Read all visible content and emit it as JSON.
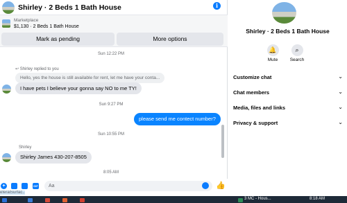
{
  "header": {
    "title": "Shirley · 2 Beds 1 Bath House",
    "info_icon": "info-icon"
  },
  "listing": {
    "category": "Marketplace",
    "summary": "$1,130 · 2 Beds 1 Bath House",
    "mark_pending_label": "Mark as pending",
    "more_options_label": "More options"
  },
  "messages": {
    "ts1": "Sun 12:22 PM",
    "reply_note": "Shirley replied to you",
    "quoted": "Hello, yes the house is still available for rent, let me have your conta...",
    "msg1": "I have pets I believe your gonna say NO to me TY!",
    "ts2": "Sun 9:27 PM",
    "msg2": "please send me contect number?",
    "ts3": "Sun 10:55 PM",
    "sender2": "Shirley",
    "msg3": "Shirley James 430-207-8505",
    "ts4": "8:05 AM"
  },
  "composer": {
    "placeholder": "Aa"
  },
  "taskbar_label": "eferalSurfac...",
  "details": {
    "title": "Shirley · 2 Beds 1 Bath House",
    "mute_label": "Mute",
    "search_label": "Search",
    "sections": [
      "Customize chat",
      "Chat members",
      "Media, files and links",
      "Privacy & support"
    ]
  },
  "taskbar": {
    "time": "8:18 AM",
    "app_text": "3 MC - Hous..."
  },
  "colors": {
    "accent": "#0a84ff",
    "bubble_in": "#e4e6eb",
    "taskbar": "#1e2a38"
  }
}
